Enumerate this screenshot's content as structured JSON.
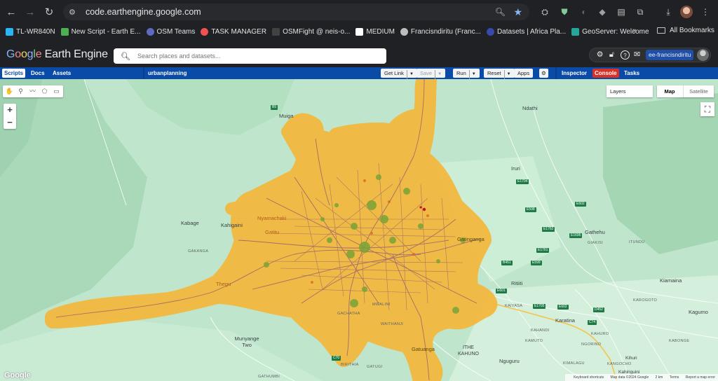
{
  "browser": {
    "url": "code.earthengine.google.com",
    "bookmarks": [
      {
        "label": "TL-WR840N",
        "color": "#29b6f6"
      },
      {
        "label": "New Script - Earth E...",
        "color": "#4caf50"
      },
      {
        "label": "OSM Teams",
        "color": "#5c6bc0"
      },
      {
        "label": "TASK MANAGER",
        "color": "#ef5350"
      },
      {
        "label": "OSMFight @ neis-o...",
        "color": "#424242"
      },
      {
        "label": "MEDIUM",
        "color": "#ffffff"
      },
      {
        "label": "Francisndiritu (Franc...",
        "color": "#bdbdbd"
      },
      {
        "label": "Datasets | Africa Pla...",
        "color": "#3949ab"
      },
      {
        "label": "GeoServer: Welcome",
        "color": "#26a69a"
      }
    ],
    "all_bookmarks": "All Bookmarks"
  },
  "ee": {
    "logo_google": [
      "G",
      "o",
      "o",
      "g",
      "l",
      "e"
    ],
    "logo_rest": "Earth Engine",
    "search_placeholder": "Search places and datasets...",
    "user": "ee-francisndiritu",
    "tabs_left": {
      "scripts": "Scripts",
      "docs": "Docs",
      "assets": "Assets"
    },
    "script_name": "urbanplanning",
    "buttons": {
      "get_link": "Get Link",
      "save": "Save",
      "run": "Run",
      "reset": "Reset",
      "apps": "Apps"
    },
    "tabs_right": {
      "inspector": "Inspector",
      "console": "Console",
      "tasks": "Tasks"
    }
  },
  "map": {
    "layers": "Layers",
    "map_type": {
      "map": "Map",
      "satellite": "Satellite"
    },
    "places": [
      {
        "name": "Muiga"
      },
      {
        "name": "Ndathi"
      },
      {
        "name": "Iruri"
      },
      {
        "name": "Kabage"
      },
      {
        "name": "Kahigaini"
      },
      {
        "name": "Nyamachaki"
      },
      {
        "name": "Gathehu"
      },
      {
        "name": "Gatitu"
      },
      {
        "name": "Gatinganga"
      },
      {
        "name": "Ritiiti"
      },
      {
        "name": "Kiamaina"
      },
      {
        "name": "Kagumo"
      },
      {
        "name": "Karatina"
      },
      {
        "name": "Munyange Two"
      },
      {
        "name": "Gatuanga"
      },
      {
        "name": "ITHE KAHUNO"
      },
      {
        "name": "Nguguru"
      },
      {
        "name": "Thegu"
      },
      {
        "name": "Kihuri"
      },
      {
        "name": "Kahiriguini"
      }
    ],
    "small_labels": [
      "GAKANGA",
      "GIAKISI",
      "ITUNDU",
      "KAIYASA",
      "KAHANDI",
      "KAHURO",
      "KAROGOTO",
      "KAMUTO",
      "KABONGE",
      "KIMALAGU",
      "KANGOCHO",
      "NGORINO",
      "BIRITHIA",
      "GATUGI",
      "GATHUMBI",
      "GACHATHA",
      "WAITHANJI",
      "MWALINI",
      "KAIYASA"
    ],
    "roads": [
      "B5",
      "E1704",
      "E598",
      "E602",
      "E1762",
      "E1696",
      "E1761",
      "E599",
      "E601",
      "E1705",
      "E602",
      "D452",
      "C74",
      "C70",
      "B451"
    ],
    "google_logo": "Google",
    "attribution": [
      "Keyboard shortcuts",
      "Map data ©2024 Google",
      "2 km",
      "Terms",
      "Report a map error"
    ]
  }
}
